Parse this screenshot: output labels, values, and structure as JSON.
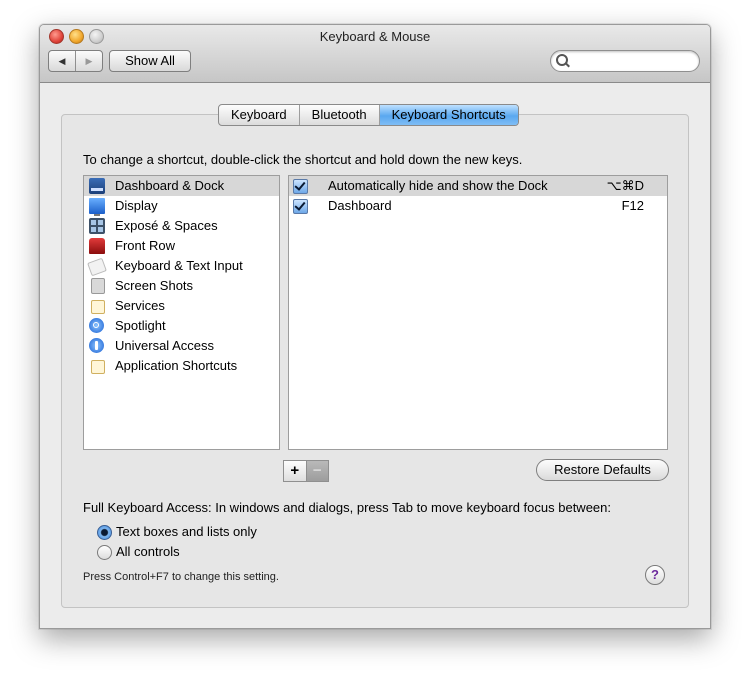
{
  "window": {
    "title": "Keyboard & Mouse"
  },
  "toolbar": {
    "back_glyph": "◀",
    "forward_glyph": "▶",
    "show_all_label": "Show All",
    "search": {
      "value": "",
      "placeholder": "",
      "icon": "magnifier-icon"
    }
  },
  "tabs": [
    {
      "label": "Keyboard",
      "selected": false
    },
    {
      "label": "Bluetooth",
      "selected": false
    },
    {
      "label": "Keyboard Shortcuts",
      "selected": true
    }
  ],
  "instructions": "To change a shortcut, double-click the shortcut and hold down the new keys.",
  "categories": [
    {
      "label": "Dashboard & Dock",
      "icon": "dock-icon",
      "selected": true
    },
    {
      "label": "Display",
      "icon": "display-icon"
    },
    {
      "label": "Exposé & Spaces",
      "icon": "expose-icon"
    },
    {
      "label": "Front Row",
      "icon": "front-row-icon"
    },
    {
      "label": "Keyboard & Text Input",
      "icon": "keyboard-icon"
    },
    {
      "label": "Screen Shots",
      "icon": "screen-shots-icon"
    },
    {
      "label": "Services",
      "icon": "services-icon"
    },
    {
      "label": "Spotlight",
      "icon": "spotlight-icon"
    },
    {
      "label": "Universal Access",
      "icon": "universal-access-icon"
    },
    {
      "label": "Application Shortcuts",
      "icon": "app-shortcuts-icon"
    }
  ],
  "shortcuts": [
    {
      "label": "Automatically hide and show the Dock",
      "key": "⌥⌘D",
      "checked": true,
      "selected": true
    },
    {
      "label": "Dashboard",
      "key": "F12",
      "checked": true,
      "selected": false
    }
  ],
  "buttons": {
    "add": "+",
    "remove": "−",
    "restore_defaults": "Restore Defaults"
  },
  "full_keyboard_access": {
    "label": "Full Keyboard Access: In windows and dialogs, press Tab to move keyboard focus between:",
    "options": [
      {
        "label": "Text boxes and lists only",
        "selected": true
      },
      {
        "label": "All controls",
        "selected": false
      }
    ],
    "note": "Press Control+F7 to change this setting."
  },
  "help_glyph": "?"
}
